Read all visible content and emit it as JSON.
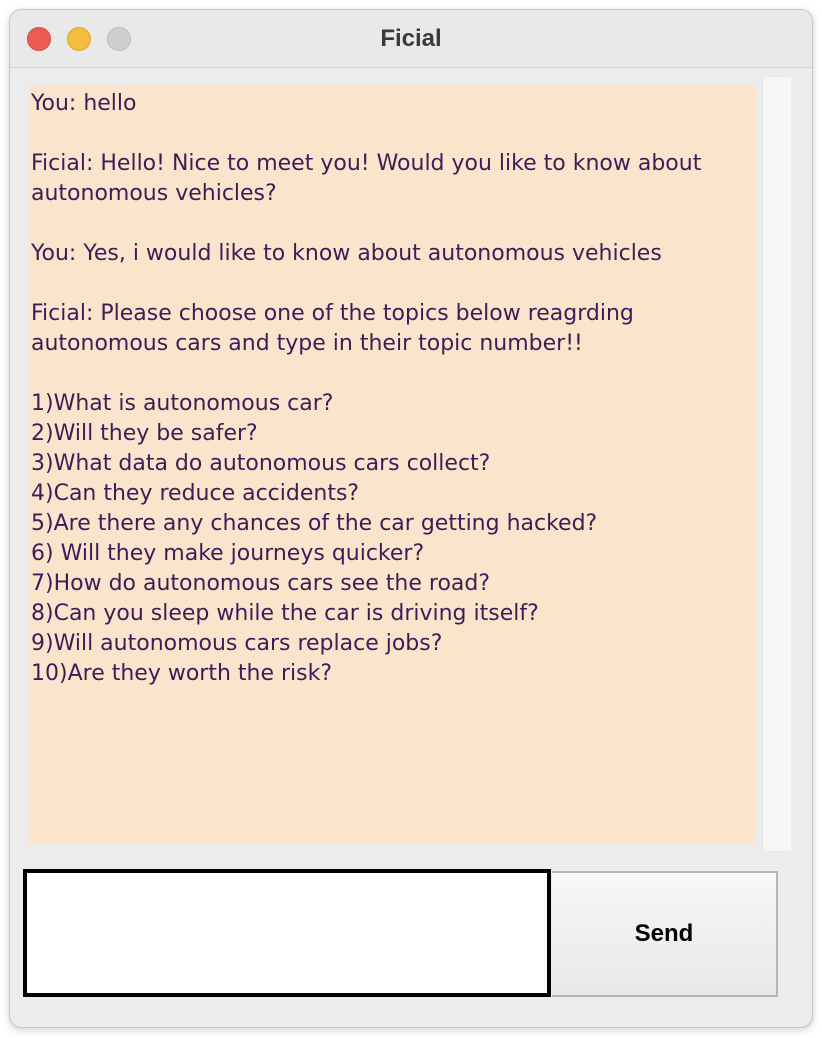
{
  "window": {
    "title": "Ficial"
  },
  "chat": {
    "transcript": "You: hello\n\nFicial: Hello! Nice to meet you! Would you like to know about autonomous vehicles?\n\nYou: Yes, i would like to know about autonomous vehicles\n\nFicial: Please choose one of the topics below reagrding autonomous cars and type in their topic number!!\n\n1)What is autonomous car?\n2)Will they be safer?\n3)What data do autonomous cars collect?\n4)Can they reduce accidents?\n5)Are there any chances of the car getting hacked?\n6) Will they make journeys quicker?\n7)How do autonomous cars see the road?\n8)Can you sleep while the car is driving itself?\n9)Will autonomous cars replace jobs?\n10)Are they worth the risk?"
  },
  "input": {
    "value": "",
    "placeholder": ""
  },
  "send_button": {
    "label": "Send"
  },
  "colors": {
    "chat_background": "#fce4cc",
    "chat_text": "#3a1e57",
    "close": "#ee5b53",
    "minimize": "#f4bd3f",
    "zoom_inactive": "#cfcfcf"
  },
  "icons": {
    "close": "close-traffic-light-icon",
    "minimize": "minimize-traffic-light-icon",
    "zoom": "zoom-traffic-light-icon"
  }
}
